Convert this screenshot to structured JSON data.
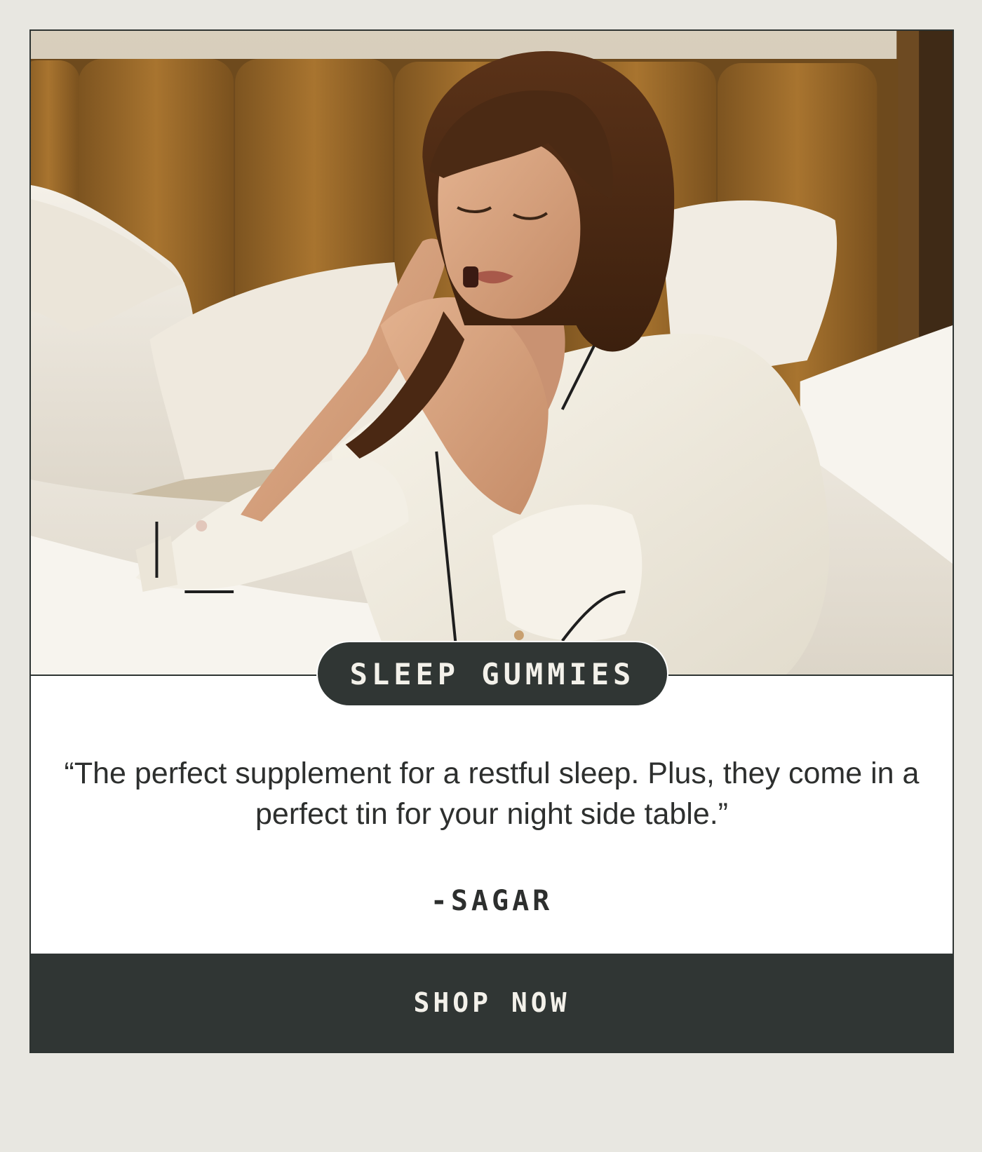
{
  "hero": {
    "image": "woman-in-bed-eating-gummy-photo"
  },
  "badge": {
    "label": "SLEEP GUMMIES"
  },
  "testimonial": {
    "quote": "“The perfect supplement for a restful sleep. Plus, they come in a perfect tin for your night side table.”",
    "author": "-SAGAR"
  },
  "cta": {
    "label": "SHOP NOW"
  },
  "colors": {
    "page_background": "#e8e7e1",
    "card_background": "#ffffff",
    "dark": "#303634",
    "light_text": "#f3f1ea",
    "body_text": "#2d2f2e",
    "headboard": "#9a6a2e",
    "linen": "#f1ece2"
  }
}
